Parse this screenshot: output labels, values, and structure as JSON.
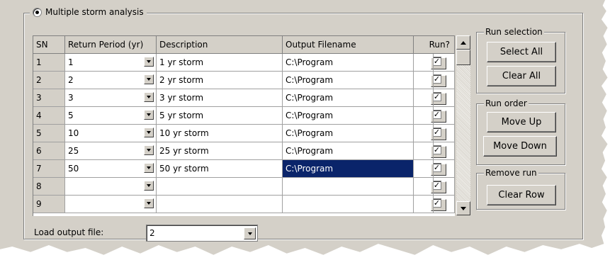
{
  "group": {
    "title": "Multiple storm analysis",
    "selected": true
  },
  "grid": {
    "headers": {
      "sn": "SN",
      "return_period": "Return Period (yr)",
      "description": "Description",
      "output_filename": "Output Filename",
      "run": "Run?"
    },
    "rows": [
      {
        "sn": "1",
        "period": "1",
        "desc": "1 yr storm",
        "out": "C:\\Program",
        "run": true
      },
      {
        "sn": "2",
        "period": "2",
        "desc": "2 yr storm",
        "out": "C:\\Program",
        "run": true
      },
      {
        "sn": "3",
        "period": "3",
        "desc": "3 yr storm",
        "out": "C:\\Program",
        "run": true
      },
      {
        "sn": "4",
        "period": "5",
        "desc": "5 yr storm",
        "out": "C:\\Program",
        "run": true
      },
      {
        "sn": "5",
        "period": "10",
        "desc": "10 yr storm",
        "out": "C:\\Program",
        "run": true
      },
      {
        "sn": "6",
        "period": "25",
        "desc": "25 yr storm",
        "out": "C:\\Program",
        "run": true
      },
      {
        "sn": "7",
        "period": "50",
        "desc": "50 yr storm",
        "out": "C:\\Program",
        "run": true
      },
      {
        "sn": "8",
        "period": "",
        "desc": "",
        "out": "",
        "run": true
      },
      {
        "sn": "9",
        "period": "",
        "desc": "",
        "out": "",
        "run": true
      }
    ],
    "selected_row": 6,
    "browse_label": "...",
    "check_mark": "✓"
  },
  "run_selection": {
    "title": "Run selection",
    "select_all": "Select All",
    "clear_all": "Clear All"
  },
  "run_order": {
    "title": "Run order",
    "move_up": "Move Up",
    "move_down": "Move Down"
  },
  "remove_run": {
    "title": "Remove run",
    "clear_row": "Clear Row"
  },
  "load_output": {
    "label": "Load output file:",
    "value": "2"
  },
  "colors": {
    "face": "#d4d0c8",
    "selection": "#0a246a"
  }
}
